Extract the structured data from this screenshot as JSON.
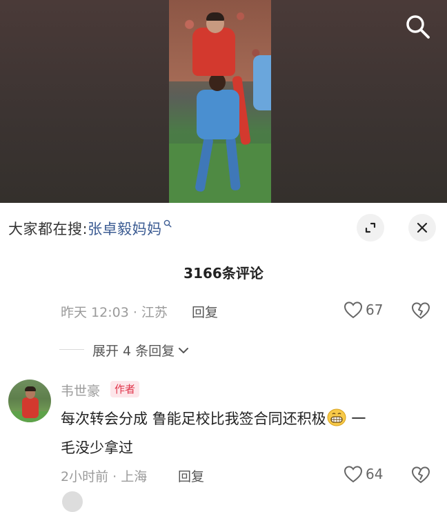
{
  "header": {
    "search_icon": "search-icon"
  },
  "hot_search": {
    "prefix": "大家都在搜:",
    "term": "张卓毅妈妈"
  },
  "controls": {
    "expand_icon": "expand-icon",
    "close_icon": "close-icon"
  },
  "comments_count": "3166条评论",
  "prev_comment": {
    "time_location": "昨天 12:03 · 江苏",
    "reply_label": "回复",
    "likes": "67"
  },
  "expand_replies": {
    "label": "展开 4 条回复"
  },
  "comment": {
    "username": "韦世豪",
    "tag": "作者",
    "text_line1": "每次转会分成 鲁能足校比我签合同还积极",
    "text_tail": " 一",
    "text_line2": "毛没少拿过",
    "emoji": "grinning-face",
    "time_location": "2小时前 · 上海",
    "reply_label": "回复",
    "likes": "64"
  },
  "colors": {
    "accent_blue": "#3b5b92",
    "author_tag": "#e0344a",
    "meta_gray": "#9a9a9a"
  }
}
